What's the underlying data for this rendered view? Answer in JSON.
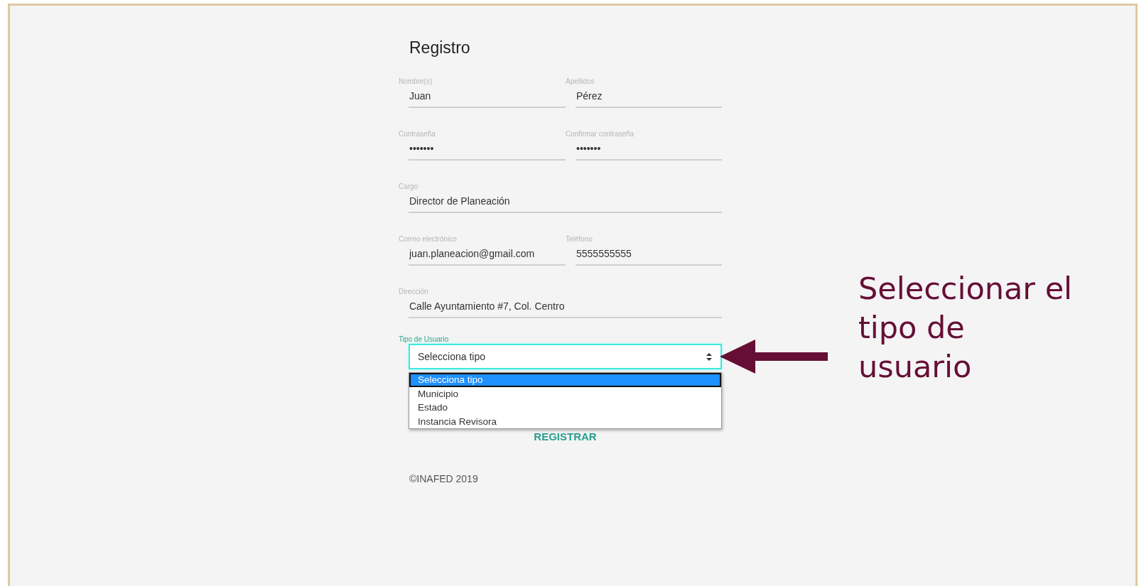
{
  "title": "Registro",
  "rows": [
    {
      "fields": [
        {
          "label": "Nombre(s)",
          "value": "Juan"
        },
        {
          "label": "Apellidos",
          "value": "Pérez"
        }
      ]
    },
    {
      "fields": [
        {
          "label": "Contraseña",
          "value": "•••••••"
        },
        {
          "label": "Confirmar contraseña",
          "value": "•••••••"
        }
      ]
    },
    {
      "fields": [
        {
          "label": "Cargo",
          "value": "Director de Planeación"
        }
      ]
    },
    {
      "fields": [
        {
          "label": "Correo electrónico",
          "value": "juan.planeacion@gmail.com"
        },
        {
          "label": "Teléfono",
          "value": "5555555555"
        }
      ]
    },
    {
      "fields": [
        {
          "label": "Dirección",
          "value": "Calle Ayuntamiento #7, Col. Centro"
        }
      ]
    }
  ],
  "user_type": {
    "label": "Tipo de Usuario",
    "value": "Selecciona tipo",
    "expanded": true,
    "options": [
      {
        "label": "Selecciona tipo",
        "selected": true
      },
      {
        "label": "Municipio",
        "selected": false
      },
      {
        "label": "Estado",
        "selected": false
      },
      {
        "label": "Instancia Revisora",
        "selected": false
      }
    ]
  },
  "submit_button": "REGISTRAR",
  "footer": "©INAFED 2019",
  "annotation": {
    "text": "Seleccionar el tipo de usuario"
  }
}
